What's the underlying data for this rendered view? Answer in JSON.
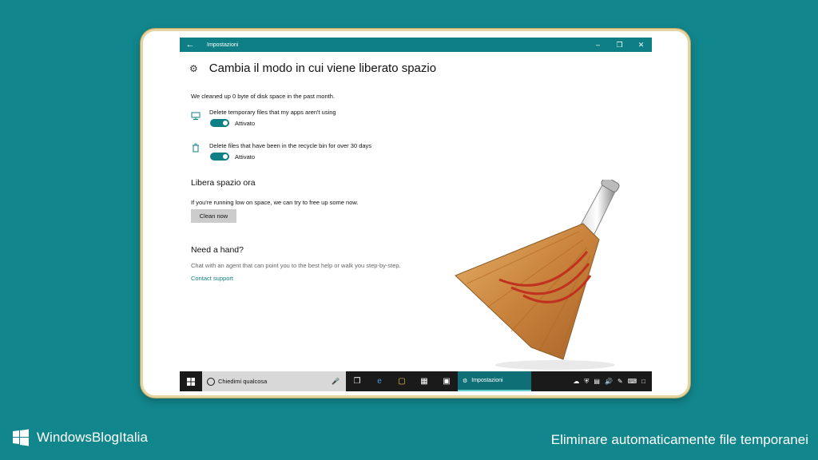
{
  "window": {
    "title": "Impostazioni",
    "back_icon": "arrow-left-icon",
    "controls": [
      "minimize",
      "restore",
      "close"
    ]
  },
  "settings": {
    "page_title": "Cambia il modo in cui viene liberato spazio",
    "cleaned_text": "We cleaned up 0 byte of disk space in the past month.",
    "option1": {
      "label": "Delete temporary files that my apps aren't using",
      "state": "Attivato"
    },
    "option2": {
      "label": "Delete files that have been in the recycle bin for over 30 days",
      "state": "Attivato"
    },
    "section_free": {
      "title": "Libera spazio ora",
      "text": "If you're running low on space, we can try to free up some now.",
      "button": "Clean now"
    },
    "section_help": {
      "title": "Need a hand?",
      "text": "Chat with an agent that can point you to the best help or walk you step-by-step.",
      "link": "Contact support"
    }
  },
  "taskbar": {
    "search_placeholder": "Chiedimi qualcosa",
    "active_app": "Impostazioni"
  },
  "branding": {
    "site": "WindowsBlogItalia",
    "caption": "Eliminare automaticamente file temporanei"
  },
  "colors": {
    "background": "#11868c",
    "accent": "#0f7f86",
    "taskbar": "#1a1a1a"
  }
}
